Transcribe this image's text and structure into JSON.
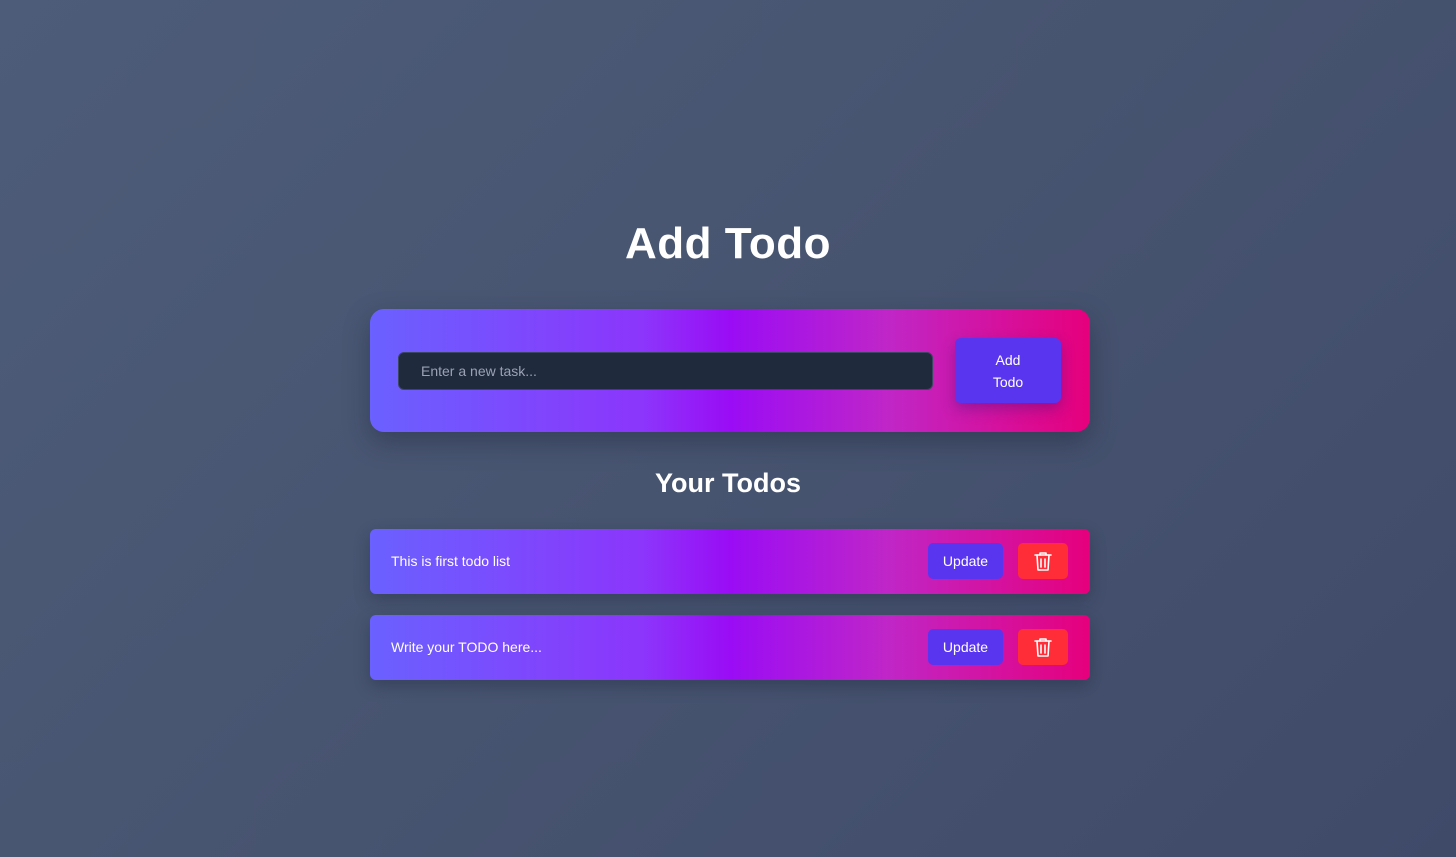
{
  "header": {
    "title": "Add Todo"
  },
  "add_form": {
    "input_value": "",
    "input_placeholder": "Enter a new task...",
    "add_label": "Add Todo"
  },
  "todos_section": {
    "title": "Your Todos",
    "items": [
      {
        "text": "This is first todo list",
        "update_label": "Update",
        "delete_icon": "trash-icon"
      },
      {
        "text": "Write your TODO here...",
        "update_label": "Update",
        "delete_icon": "trash-icon"
      }
    ]
  },
  "colors": {
    "background": "#475470",
    "gradient_start": "#6a61ff",
    "gradient_mid": "#9a0cf5",
    "gradient_end": "#e6007c",
    "button_primary": "#5a35f0",
    "button_danger": "#ff2d37",
    "input_bg": "#1f2a3c"
  }
}
